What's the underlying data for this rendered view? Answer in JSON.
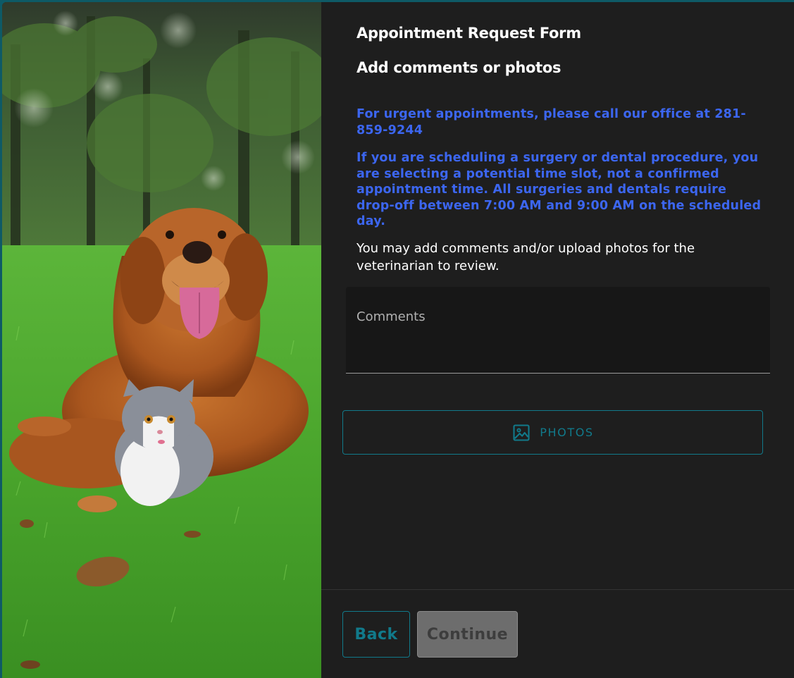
{
  "form": {
    "title": "Appointment Request Form",
    "subtitle": "Add comments or photos",
    "notice_urgent": "For urgent appointments, please call our office at 281-859-9244",
    "notice_surgery": "If you are scheduling a surgery or dental procedure, you are selecting a potential time slot, not a confirmed appointment time. All surgeries and dentals require drop-off between 7:00 AM and 9:00 AM on the scheduled day.",
    "instructions": "You may add comments and/or upload photos for the veterinarian to review.",
    "comments": {
      "placeholder": "Comments",
      "value": ""
    },
    "photos_button_label": "PHOTOS",
    "photos_icon": "image-icon"
  },
  "footer": {
    "back_label": "Back",
    "continue_label": "Continue",
    "continue_disabled": true
  },
  "colors": {
    "accent": "#117a8b",
    "notice_text": "#3c66f0",
    "panel_bg": "#1e1e1e",
    "outer_border": "#0e5a66",
    "disabled_button_bg": "#6d6d6d"
  }
}
